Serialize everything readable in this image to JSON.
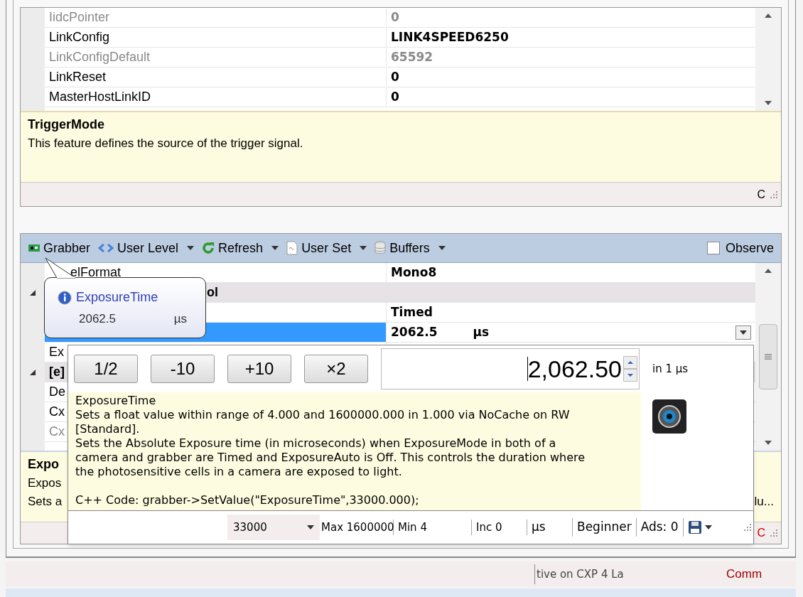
{
  "top_grid": {
    "rows": [
      {
        "name": "IidcPointer",
        "value": "0",
        "disabled": true
      },
      {
        "name": "LinkConfig",
        "value": "LINK4SPEED6250",
        "disabled": false
      },
      {
        "name": "LinkConfigDefault",
        "value": "65592",
        "disabled": true
      },
      {
        "name": "LinkReset",
        "value": "0",
        "disabled": false
      },
      {
        "name": "MasterHostLinkID",
        "value": "0",
        "disabled": false
      }
    ],
    "description": {
      "title": "TriggerMode",
      "text": "This feature defines the source of the trigger signal."
    },
    "status": "C"
  },
  "toolbar": {
    "items": [
      {
        "label": "Grabber",
        "dropdown": false
      },
      {
        "label": "User Level",
        "dropdown": true
      },
      {
        "label": "Refresh",
        "dropdown": true
      },
      {
        "label": "User Set",
        "dropdown": true
      },
      {
        "label": "Buffers",
        "dropdown": true
      }
    ],
    "observe": {
      "label": "Observe",
      "checked": false
    }
  },
  "bottom_grid": {
    "rows": [
      {
        "kind": "item",
        "name": "elFormat",
        "value": "Mono8",
        "selected": false,
        "disabled": false
      },
      {
        "kind": "category",
        "name": "ol",
        "value": "",
        "selected": false,
        "disabled": false
      },
      {
        "kind": "item",
        "name": "",
        "value": "Timed",
        "selected": false,
        "disabled": false
      },
      {
        "kind": "edit",
        "name": "",
        "value": "2062.5",
        "unit": "µs",
        "selected": true,
        "disabled": false
      },
      {
        "kind": "item",
        "name": "Ex",
        "value": "",
        "selected": false,
        "disabled": false
      },
      {
        "kind": "category",
        "name": "[e]",
        "value": "",
        "selected": false,
        "disabled": false
      },
      {
        "kind": "item",
        "name": "De",
        "value": "",
        "selected": false,
        "disabled": false
      },
      {
        "kind": "item",
        "name": "Cx",
        "value": "",
        "selected": false,
        "disabled": false
      },
      {
        "kind": "item",
        "name": "Cx",
        "value": "",
        "selected": false,
        "disabled": true
      }
    ],
    "description": {
      "title": "Expo",
      "line_1": "Expos",
      "line_2": "Sets a",
      "line_2_end": "lu..."
    },
    "status": "C"
  },
  "tooltip": {
    "title": "ExposureTime",
    "value": "2062.5",
    "unit": "µs"
  },
  "editor": {
    "buttons": [
      "1/2",
      "-10",
      "+10",
      "×2"
    ],
    "value": "2,062.50",
    "increment": "in 1 µs",
    "help": {
      "lines": [
        "ExposureTime",
        "Sets a float value within range of 4.000 and 1600000.000 in 1.000 via NoCache on RW",
        "[Standard].",
        "Sets the Absolute Exposure time (in microseconds) when ExposureMode in both of a",
        "camera and grabber are Timed and ExposureAuto is Off. This controls the duration where",
        "the photosensitive cells in a camera are exposed to light."
      ],
      "code": "C++ Code: grabber->SetValue(\"ExposureTime\",33000.000);"
    },
    "footer": {
      "preset": "33000",
      "max": "Max 1600000",
      "min": "Min 4",
      "inc": "Inc 0",
      "unit": "µs",
      "level": "Beginner",
      "ads": "Ads: 0"
    }
  },
  "status_bar": {
    "message": "tive on CXP 4 La",
    "connection": "Comm"
  }
}
